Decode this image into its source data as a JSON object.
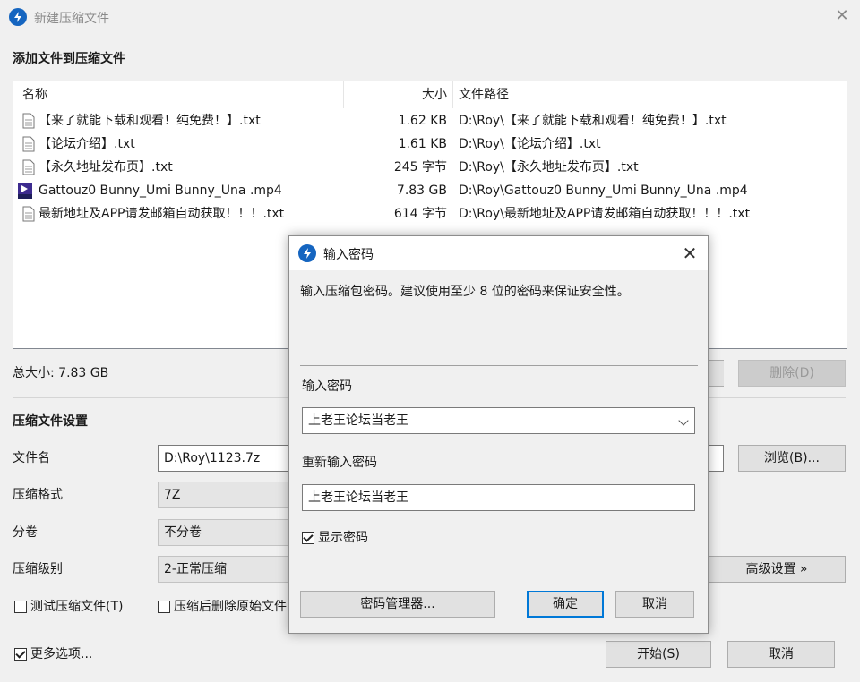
{
  "window": {
    "title": "新建压缩文件",
    "close_symbol": "✕"
  },
  "file_section": {
    "title": "添加文件到压缩文件",
    "columns": {
      "name": "名称",
      "size": "大小",
      "path": "文件路径"
    },
    "files": [
      {
        "name": "【来了就能下载和观看！纯免费！】.txt",
        "size": "1.62 KB",
        "path": "D:\\Roy\\【来了就能下载和观看！纯免费！】.txt",
        "icon": "text-file-icon"
      },
      {
        "name": "【论坛介绍】.txt",
        "size": "1.61 KB",
        "path": "D:\\Roy\\【论坛介绍】.txt",
        "icon": "text-file-icon"
      },
      {
        "name": "【永久地址发布页】.txt",
        "size": "245 字节",
        "path": "D:\\Roy\\【永久地址发布页】.txt",
        "icon": "text-file-icon"
      },
      {
        "name": "Gattouz0 Bunny_Umi Bunny_Una .mp4",
        "size": "7.83 GB",
        "path": "D:\\Roy\\Gattouz0 Bunny_Umi Bunny_Una .mp4",
        "icon": "video-file-icon"
      },
      {
        "name": "最新地址及APP请发邮箱自动获取！！！.txt",
        "size": "614 字节",
        "path": "D:\\Roy\\最新地址及APP请发邮箱自动获取！！！.txt",
        "icon": "text-file-icon"
      }
    ],
    "total_size": "总大小: 7.83 GB",
    "delete_button": "删除(D)"
  },
  "settings": {
    "title": "压缩文件设置",
    "filename_label": "文件名",
    "filename_value": "D:\\Roy\\1123.7z",
    "browse_button": "浏览(B)...",
    "format_label": "压缩格式",
    "format_value": "7Z",
    "volume_label": "分卷",
    "volume_value": "不分卷",
    "level_label": "压缩级别",
    "level_value": "2-正常压缩",
    "advanced_button": "高级设置 »",
    "test_checkbox": "测试压缩文件(T)",
    "delete_after_checkbox": "压缩后删除原始文件"
  },
  "footer": {
    "more_options": "更多选项...",
    "start_button": "开始(S)",
    "cancel_button": "取消"
  },
  "dialog": {
    "title": "输入密码",
    "close_symbol": "✕",
    "description": "输入压缩包密码。建议使用至少 8 位的密码来保证安全性。",
    "password_label": "输入密码",
    "password_value": "上老王论坛当老王",
    "reenter_label": "重新输入密码",
    "reenter_value": "上老王论坛当老王",
    "show_password": "显示密码",
    "show_password_checked": true,
    "manager_button": "密码管理器...",
    "ok_button": "确定",
    "cancel_button": "取消"
  },
  "colors": {
    "accent": "#0078d7",
    "app_icon": "#1565c0"
  }
}
